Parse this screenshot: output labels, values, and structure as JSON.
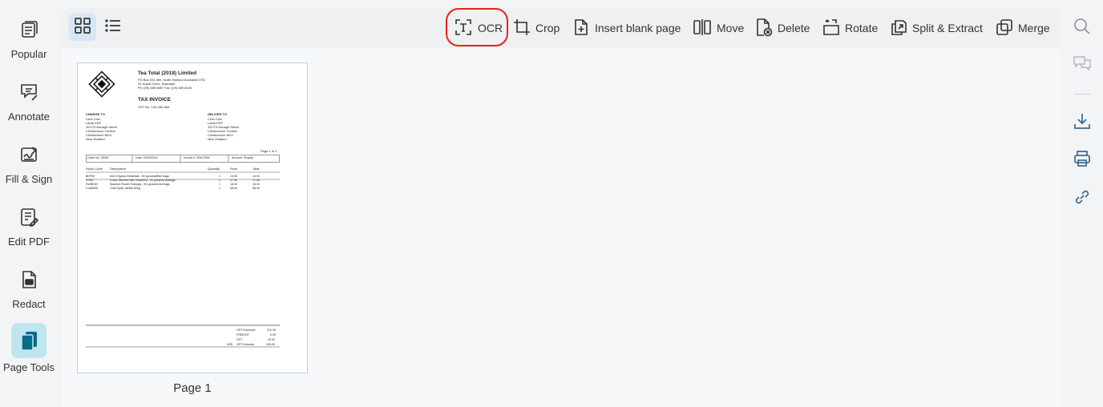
{
  "sidebar": {
    "items": [
      {
        "label": "Popular",
        "icon": "popular-icon"
      },
      {
        "label": "Annotate",
        "icon": "annotate-icon"
      },
      {
        "label": "Fill & Sign",
        "icon": "fill-sign-icon"
      },
      {
        "label": "Edit PDF",
        "icon": "edit-pdf-icon"
      },
      {
        "label": "Redact",
        "icon": "redact-icon"
      },
      {
        "label": "Page Tools",
        "icon": "page-tools-icon",
        "active": true
      }
    ]
  },
  "toolbar": {
    "views": [
      "grid-view",
      "list-view"
    ],
    "tools": [
      {
        "label": "OCR",
        "icon": "ocr-icon",
        "highlighted": true
      },
      {
        "label": "Crop",
        "icon": "crop-icon"
      },
      {
        "label": "Insert blank page",
        "icon": "insert-page-icon"
      },
      {
        "label": "Move",
        "icon": "move-icon"
      },
      {
        "label": "Delete",
        "icon": "delete-icon"
      },
      {
        "label": "Rotate",
        "icon": "rotate-icon"
      },
      {
        "label": "Split & Extract",
        "icon": "split-extract-icon"
      },
      {
        "label": "Merge",
        "icon": "merge-icon"
      }
    ]
  },
  "pages": [
    {
      "label": "Page 1",
      "document": {
        "company": "Tea Total (2018) Limited",
        "address_lines": [
          "PO Box 331 489, North Harbour Auckland 0751",
          "St. Austin Drive, Rosedale",
          "Ph: (09) 489 0897 Fax: (09) 489 0828"
        ],
        "heading": "TAX INVOICE",
        "gst_no": "GST No. 129-440-564",
        "charge_to_label": "CHARGE TO",
        "charge_to_lines": [
          "Civic Crux",
          "Lamb PDF",
          "167/73 Armagh Street",
          "Christchurch Central",
          "Christchurch 8011",
          "New Zealand"
        ],
        "deliver_to_label": "DELIVER TO",
        "deliver_to_lines": [
          "Civic Crux",
          "Lamb PDF",
          "157/73 Armagh Street",
          "Christchurch Central",
          "Christchurch 8011",
          "New Zealand"
        ],
        "page_of": "Page 1 of 1",
        "order_row": [
          "Order No. 25001",
          "Date: 09/03/2024",
          "Invoice #: 30417906",
          "Account: Shopify"
        ],
        "table_headers": [
          "Stock Code",
          "Description",
          "Quantity",
          "Price",
          "Total"
        ],
        "table_rows": [
          [
            "BKF50",
            "Irish Organic Breakfast - 50 pyramid/filter bags",
            "1",
            "14.50",
            "14.50"
          ],
          [
            "PG50",
            "Cross Jasmine with Gardenia - 50 pyramid teabags",
            "1",
            "17.50",
            "17.50"
          ],
          [
            "SWBK50",
            "Spanish Flower Teabags - 50 pyramid tea bags",
            "1",
            "18.00",
            "18.00"
          ],
          [
            "CVA5006",
            "Chai Spice Vanilla 500g",
            "1",
            "58.00",
            "58.00"
          ]
        ],
        "totals": [
          {
            "label": "GST Exclusive",
            "value": "212.95"
          },
          {
            "label": "FREIGHT",
            "value": "0.00"
          },
          {
            "label": "GST",
            "value": "32.00"
          },
          {
            "label": "GST Inclusive",
            "value": "245.00"
          }
        ],
        "totals_prefix": "NZD"
      }
    }
  ],
  "right_sidebar": {
    "buttons": [
      "search-icon",
      "comments-icon",
      "download-icon",
      "print-icon",
      "link-icon"
    ]
  },
  "colors": {
    "active_sidebar_bg": "#bfe6f0",
    "active_icon": "#0b6a86",
    "highlight_ring": "#e5231b",
    "thumbnail_border": "#b9cfe6"
  }
}
